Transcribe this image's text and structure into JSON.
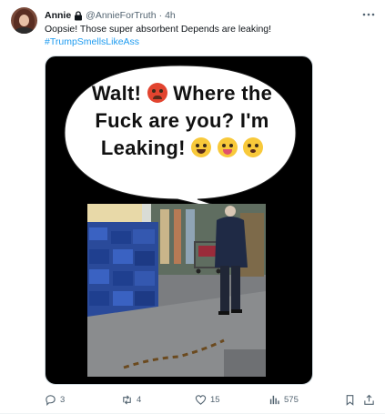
{
  "author": {
    "name": "Annie",
    "handle": "@AnnieForTruth",
    "time": "4h"
  },
  "icons": {
    "protected": "lock-icon",
    "more": "more-horizontal-icon",
    "reply": "reply-icon",
    "repost": "repost-icon",
    "like": "heart-icon",
    "views": "views-icon",
    "bookmark": "bookmark-icon",
    "share": "share-icon"
  },
  "tweet": {
    "text": "Oopsie! Those super absorbent Depends are leaking!",
    "hashtag": "#TrumpSmellsLikeAss"
  },
  "media": {
    "line1": "Walt!",
    "line1b": "Where the",
    "line2": "Fuck are you? I'm",
    "line3": "Leaking!",
    "emojis": [
      "angry-face-emoji",
      "joy-emoji",
      "tongue-out-emoji",
      "flushed-emoji"
    ]
  },
  "actions": {
    "reply_count": "3",
    "repost_count": "4",
    "like_count": "15",
    "view_count": "575"
  },
  "colors": {
    "link": "#1d9bf0",
    "secondary_text": "#536471",
    "primary_text": "#0f1419"
  }
}
